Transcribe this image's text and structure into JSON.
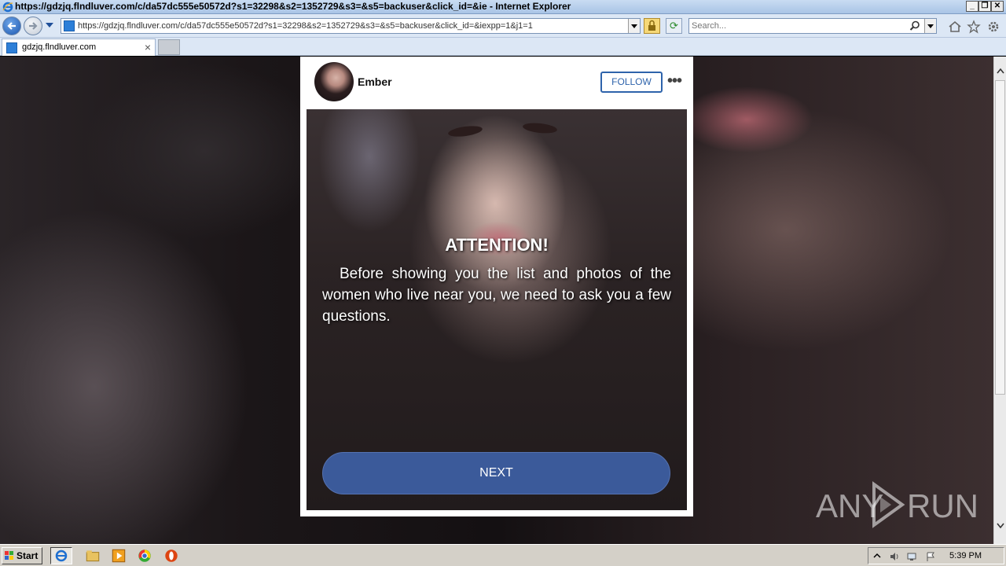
{
  "window": {
    "title": "https://gdzjq.flndluver.com/c/da57dc555e50572d?s1=32298&s2=1352729&s3=&s5=backuser&click_id=&ie - Internet Explorer"
  },
  "nav": {
    "url": "https://gdzjq.flndluver.com/c/da57dc555e50572d?s1=32298&s2=1352729&s3=&s5=backuser&click_id=&iexpp=1&j1=1",
    "search_placeholder": "Search..."
  },
  "tabs": [
    {
      "label": "gdzjq.flndluver.com",
      "active": true
    }
  ],
  "card": {
    "username": "Ember",
    "follow_label": "FOLLOW",
    "more_label": "•••",
    "attention": "ATTENTION!",
    "message": "Before showing you the list and photos of the women who live near you, we need to ask you a few questions.",
    "next_label": "NEXT"
  },
  "watermark": {
    "left": "ANY",
    "right": "RUN"
  },
  "taskbar": {
    "start_label": "Start",
    "clock": "5:39 PM"
  },
  "colors": {
    "next_button": "#3b5a9a",
    "follow_border": "#2e63ab"
  }
}
